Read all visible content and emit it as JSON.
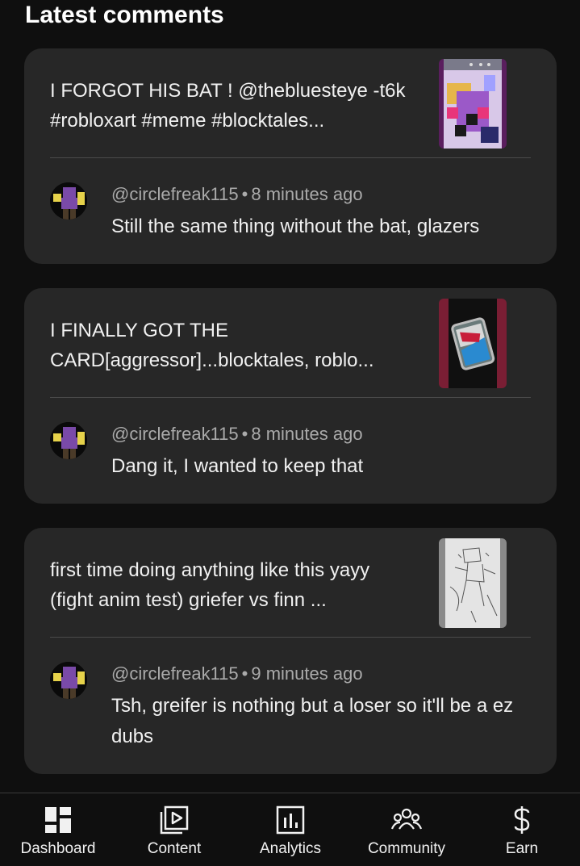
{
  "section": {
    "title": "Latest comments"
  },
  "comments": [
    {
      "video_title": "I FORGOT HIS BAT ! @thebluesteye -t6k #robloxart #meme #blocktales...",
      "author": "@circlefreak115",
      "separator": "•",
      "time": "8 minutes ago",
      "text": "Still the same thing without the bat, glazers",
      "thumbnail_icon": "pixel-art-character-thumbnail"
    },
    {
      "video_title": "I FINALLY GOT THE CARD[aggressor]...blocktales, roblo...",
      "author": "@circlefreak115",
      "separator": "•",
      "time": "8 minutes ago",
      "text": "Dang it, I wanted to keep that",
      "thumbnail_icon": "card-thumbnail"
    },
    {
      "video_title": "first time doing anything like this yayy (fight anim test) griefer vs finn ...",
      "author": "@circlefreak115",
      "separator": "•",
      "time": "9 minutes ago",
      "text": "Tsh, greifer is nothing but a loser so it'll be a ez dubs",
      "thumbnail_icon": "sketch-thumbnail"
    }
  ],
  "nav": {
    "items": [
      {
        "label": "Dashboard",
        "icon": "dashboard-icon"
      },
      {
        "label": "Content",
        "icon": "content-icon"
      },
      {
        "label": "Analytics",
        "icon": "analytics-icon"
      },
      {
        "label": "Community",
        "icon": "community-icon"
      },
      {
        "label": "Earn",
        "icon": "dollar-icon"
      }
    ]
  },
  "colors": {
    "background": "#0f0f0f",
    "card": "#272727",
    "text_primary": "#f1f1f1",
    "text_secondary": "#aaaaaa"
  }
}
